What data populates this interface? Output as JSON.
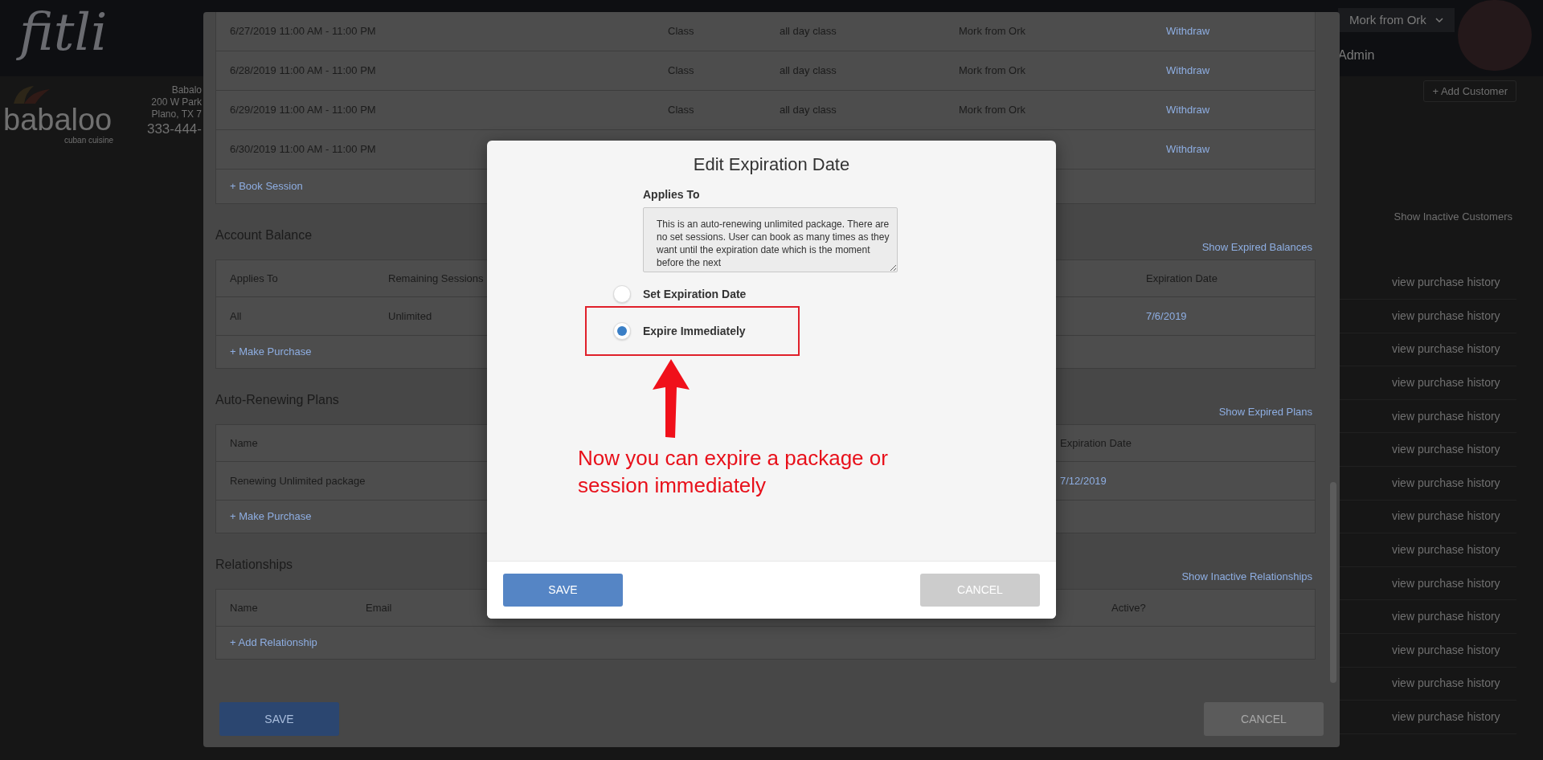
{
  "app_header": {
    "logo": "fitli",
    "account_menu": "Mork from Ork",
    "role": "Admin"
  },
  "business": {
    "logo_name": "babaloo",
    "logo_tagline": "cuban cuisine",
    "name": "Babalo",
    "address_line_1": "200 W Park",
    "address_line_2": "Plano, TX 7",
    "phone": "333-444-"
  },
  "customers": {
    "add_button": "+ Add Customer",
    "show_inactive_link": "Show Inactive Customers",
    "rows": [
      {
        "link": "view purchase history"
      },
      {
        "link": "view purchase history"
      },
      {
        "link": "view purchase history"
      },
      {
        "link": "view purchase history"
      },
      {
        "link": "view purchase history"
      },
      {
        "link": "view purchase history"
      },
      {
        "link": "view purchase history"
      },
      {
        "link": "view purchase history"
      },
      {
        "link": "view purchase history"
      },
      {
        "link": "view purchase history"
      },
      {
        "link": "view purchase history"
      },
      {
        "link": "view purchase history"
      },
      {
        "link": "view purchase history"
      },
      {
        "link": "view purchase history"
      }
    ]
  },
  "customer_detail": {
    "sessions": {
      "rows": [
        [
          {
            "text": "6/27/2019 11:00 AM - 11:00 PM",
            "kind": "text"
          },
          {
            "text": "Class",
            "kind": "text"
          },
          {
            "text": "all day class",
            "kind": "text"
          },
          {
            "text": "Mork from Ork",
            "kind": "text"
          },
          {
            "text": "Withdraw",
            "kind": "link"
          }
        ],
        [
          {
            "text": "6/28/2019 11:00 AM - 11:00 PM",
            "kind": "text"
          },
          {
            "text": "Class",
            "kind": "text"
          },
          {
            "text": "all day class",
            "kind": "text"
          },
          {
            "text": "Mork from Ork",
            "kind": "text"
          },
          {
            "text": "Withdraw",
            "kind": "link"
          }
        ],
        [
          {
            "text": "6/29/2019 11:00 AM - 11:00 PM",
            "kind": "text"
          },
          {
            "text": "Class",
            "kind": "text"
          },
          {
            "text": "all day class",
            "kind": "text"
          },
          {
            "text": "Mork from Ork",
            "kind": "text"
          },
          {
            "text": "Withdraw",
            "kind": "link"
          }
        ],
        [
          {
            "text": "6/30/2019 11:00 AM - 11:00 PM",
            "kind": "text"
          },
          {
            "text": "",
            "kind": "none"
          },
          {
            "text": "",
            "kind": "none"
          },
          {
            "text": "",
            "kind": "none"
          },
          {
            "text": "Withdraw",
            "kind": "link"
          }
        ]
      ],
      "add_link": "+ Book Session"
    },
    "sections": [
      {
        "title": "Account Balance",
        "toggle_link": "Show Expired Balances",
        "columns": [
          "Applies To",
          "Remaining Sessions",
          "Expiration Date"
        ],
        "rows": [
          [
            {
              "text": "All",
              "kind": "text"
            },
            {
              "text": "Unlimited",
              "kind": "text"
            },
            {
              "text": "7/6/2019",
              "kind": "link"
            }
          ]
        ],
        "add_link": "+ Make Purchase"
      },
      {
        "title": "Auto-Renewing Plans",
        "toggle_link": "Show Expired Plans",
        "columns": [
          "Name",
          "Expiration Date"
        ],
        "rows": [
          [
            {
              "text": "Renewing Unlimited package",
              "kind": "text"
            },
            {
              "text": "7/12/2019",
              "kind": "link"
            }
          ]
        ],
        "add_link": "+ Make Purchase"
      },
      {
        "title": "Relationships",
        "toggle_link": "Show Inactive Relationships",
        "columns": [
          "Name",
          "Email",
          "Active?"
        ],
        "add_link": "+ Add Relationship"
      }
    ],
    "save_button": "SAVE",
    "cancel_button": "CANCEL"
  },
  "dialog": {
    "title": "Edit Expiration Date",
    "applies_to_label": "Applies To",
    "applies_to_text": "This is an auto-renewing unlimited package. There are no set sessions. User can book as many times as they want until the expiration date which is the moment before the next",
    "options": [
      {
        "label": "Set Expiration Date",
        "selected": false,
        "highlighted": false
      },
      {
        "label": "Expire Immediately",
        "selected": true,
        "highlighted": true
      }
    ],
    "annotation": "Now you can expire a package or session immediately",
    "save_button": "SAVE",
    "cancel_button": "CANCEL"
  }
}
